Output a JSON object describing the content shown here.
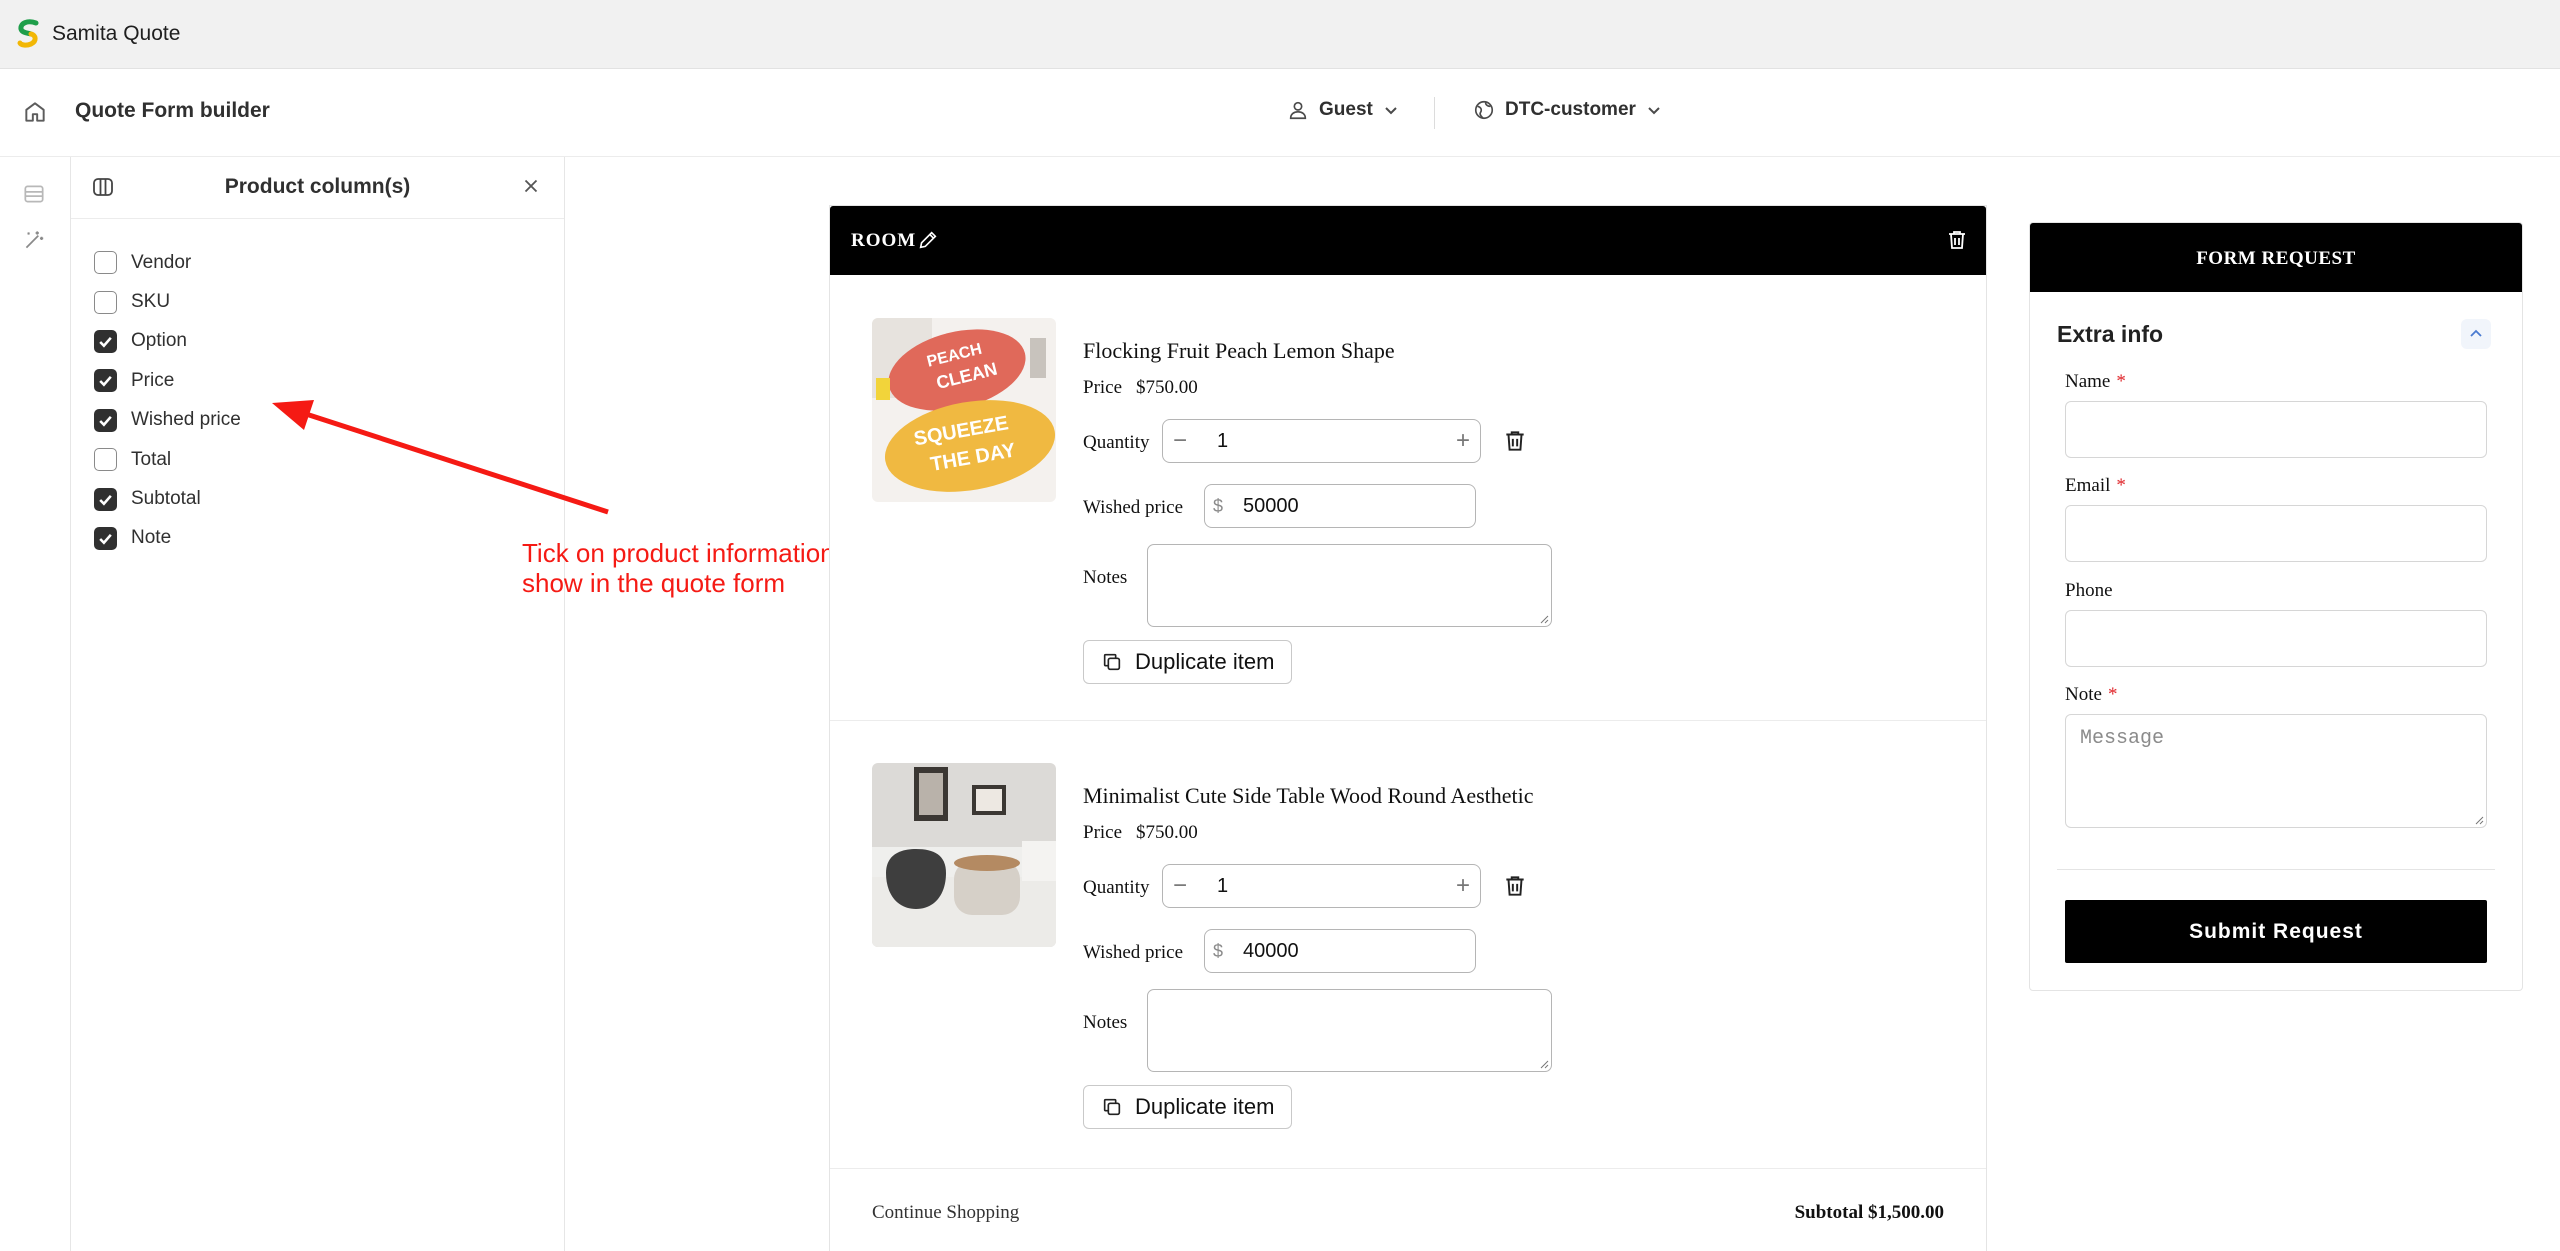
{
  "app": {
    "title": "Samita Quote"
  },
  "header": {
    "title": "Quote Form builder",
    "customer_select": "Guest",
    "market_select": "DTC-customer"
  },
  "panel": {
    "title": "Product column(s)",
    "columns": [
      {
        "label": "Vendor",
        "checked": false
      },
      {
        "label": "SKU",
        "checked": false
      },
      {
        "label": "Option",
        "checked": true
      },
      {
        "label": "Price",
        "checked": true
      },
      {
        "label": "Wished price",
        "checked": true
      },
      {
        "label": "Total",
        "checked": false
      },
      {
        "label": "Subtotal",
        "checked": true
      },
      {
        "label": "Note",
        "checked": true
      }
    ]
  },
  "annotation": {
    "text": "Tick on product information you want to show in the quote form",
    "color": "#f51a14"
  },
  "room": {
    "title": "ROOM",
    "items": [
      {
        "name": "Flocking Fruit Peach Lemon Shape",
        "price_label": "Price",
        "price": "$750.00",
        "quantity_label": "Quantity",
        "quantity": "1",
        "wished_price_label": "Wished price",
        "currency": "$",
        "wished_price": "50000",
        "notes_label": "Notes",
        "duplicate_label": "Duplicate item",
        "image_text": [
          "PEACH",
          "CLEAN",
          "SQUEEZE",
          "THE DAY"
        ]
      },
      {
        "name": "Minimalist Cute Side Table Wood Round Aesthetic",
        "price_label": "Price",
        "price": "$750.00",
        "quantity_label": "Quantity",
        "quantity": "1",
        "wished_price_label": "Wished price",
        "currency": "$",
        "wished_price": "40000",
        "notes_label": "Notes",
        "duplicate_label": "Duplicate item"
      }
    ],
    "continue_shopping": "Continue Shopping",
    "subtotal": "Subtotal $1,500.00"
  },
  "form": {
    "title": "FORM REQUEST",
    "section": "Extra info",
    "fields": {
      "name": {
        "label": "Name",
        "required": "*"
      },
      "email": {
        "label": "Email",
        "required": "*"
      },
      "phone": {
        "label": "Phone"
      },
      "note": {
        "label": "Note",
        "required": "*",
        "placeholder": "Message"
      }
    },
    "submit": "Submit Request"
  },
  "colors": {
    "brand_black": "#000000",
    "required_red": "#e0262b",
    "annotation_red": "#f51a14"
  },
  "icons": [
    "samita-logo",
    "home-icon",
    "user-icon",
    "globe-icon",
    "chevron-down-icon",
    "columns-icon",
    "close-icon",
    "edit-icon",
    "trash-icon",
    "copy-icon",
    "chevron-up-icon",
    "layout-icon",
    "magic-wand-icon"
  ]
}
